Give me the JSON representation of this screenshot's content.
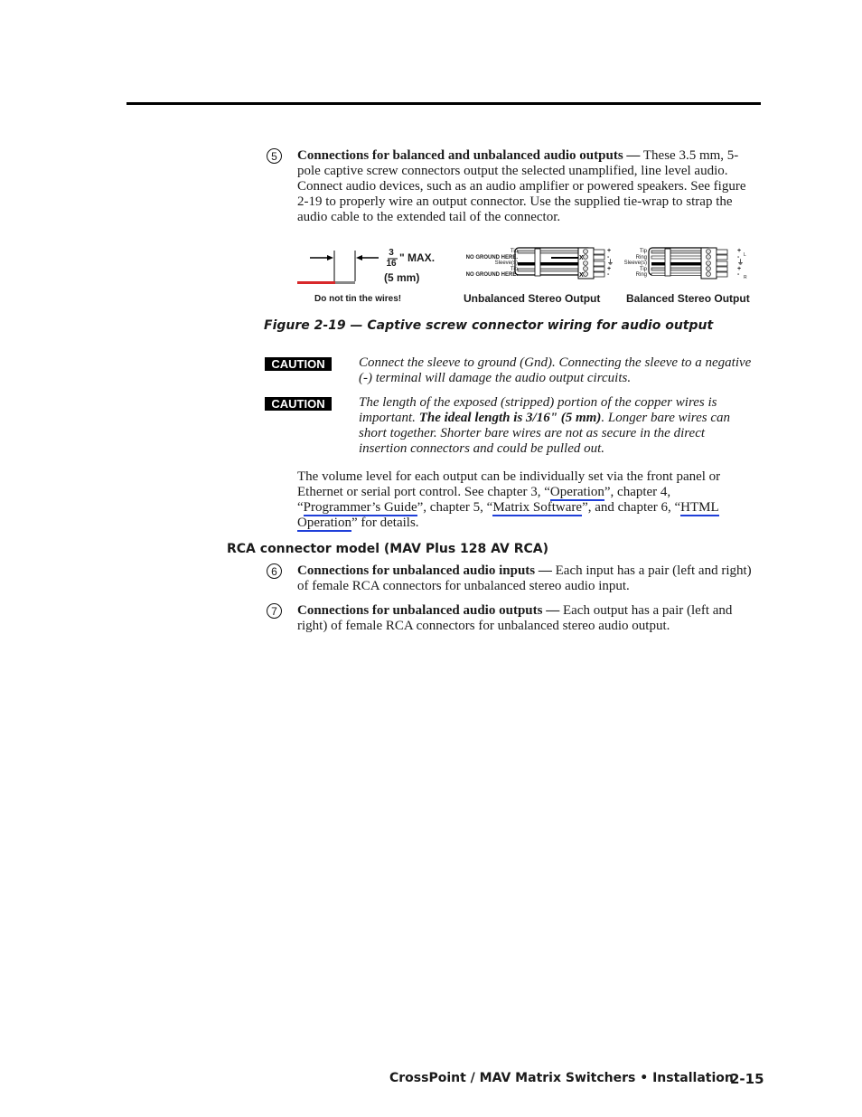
{
  "item5": {
    "number": "5",
    "heading": "Connections for balanced and unbalanced audio outputs —",
    "body": " These 3.5 mm, 5-pole captive screw connectors output the selected unamplified, line level audio.  Connect audio devices, such as an audio amplifier or powered speakers.  See figure 2-19 to properly wire an output connector.  Use the supplied tie-wrap to strap the audio cable to the extended tail of the connector."
  },
  "figure": {
    "strip_fraction": "3",
    "strip_denominator": "16",
    "strip_unit": "\" MAX.",
    "strip_mm": "(5 mm)",
    "strip_note": "Do not tin the wires!",
    "unbalanced": {
      "title": "Unbalanced Stereo Output",
      "labels": [
        "Tip",
        "NO GROUND HERE.",
        "Sleeve(s)",
        "Tip",
        "NO GROUND HERE."
      ],
      "polarity": [
        "+",
        "-",
        "⏚",
        "+",
        "-"
      ]
    },
    "balanced": {
      "title": "Balanced Stereo Output",
      "labels": [
        "Tip",
        "Ring",
        "Sleeve(s)",
        "Tip",
        "Ring"
      ],
      "polarity": [
        "+",
        "-",
        "⏚",
        "+",
        "-"
      ],
      "channels": [
        "L",
        "R"
      ]
    },
    "caption": "Figure 2-19 — Captive screw connector wiring for audio output"
  },
  "cautions": [
    {
      "badge": "CAUTION",
      "text": "Connect the sleeve to ground (Gnd).  Connecting the sleeve to a negative (-) terminal will damage the audio output circuits."
    },
    {
      "badge": "CAUTION",
      "text_before": "The length of the exposed (stripped) portion of the copper wires is important.  ",
      "text_bold": "The ideal length is 3/16\" (5 mm)",
      "text_after": ".  Longer bare wires can short together.  Shorter bare wires are not as secure in the direct insertion connectors and could be pulled out."
    }
  ],
  "volume_para": {
    "t1": "The volume level for each output can be individually set via the front panel or Ethernet or serial port control.  See chapter 3, “",
    "link1": "Operation",
    "t2": "”, chapter 4, “",
    "link2": "Programmer’s Guide",
    "t3": "”, chapter 5, “",
    "link3": "Matrix Software",
    "t4": "”, and chapter 6, “",
    "link4": "HTML Operation",
    "t5": "” for details."
  },
  "rca_heading": "RCA connector model (MAV Plus 128 AV RCA)",
  "item6": {
    "number": "6",
    "heading": "Connections for unbalanced audio inputs —",
    "body": " Each input has a pair (left and right) of female RCA connectors for unbalanced stereo audio input."
  },
  "item7": {
    "number": "7",
    "heading": "Connections for unbalanced audio outputs —",
    "body": " Each output has a pair (left and right) of female RCA connectors for unbalanced stereo audio output."
  },
  "footer": {
    "title": "CrossPoint / MAV Matrix Switchers • Installation",
    "page": "2-15"
  }
}
